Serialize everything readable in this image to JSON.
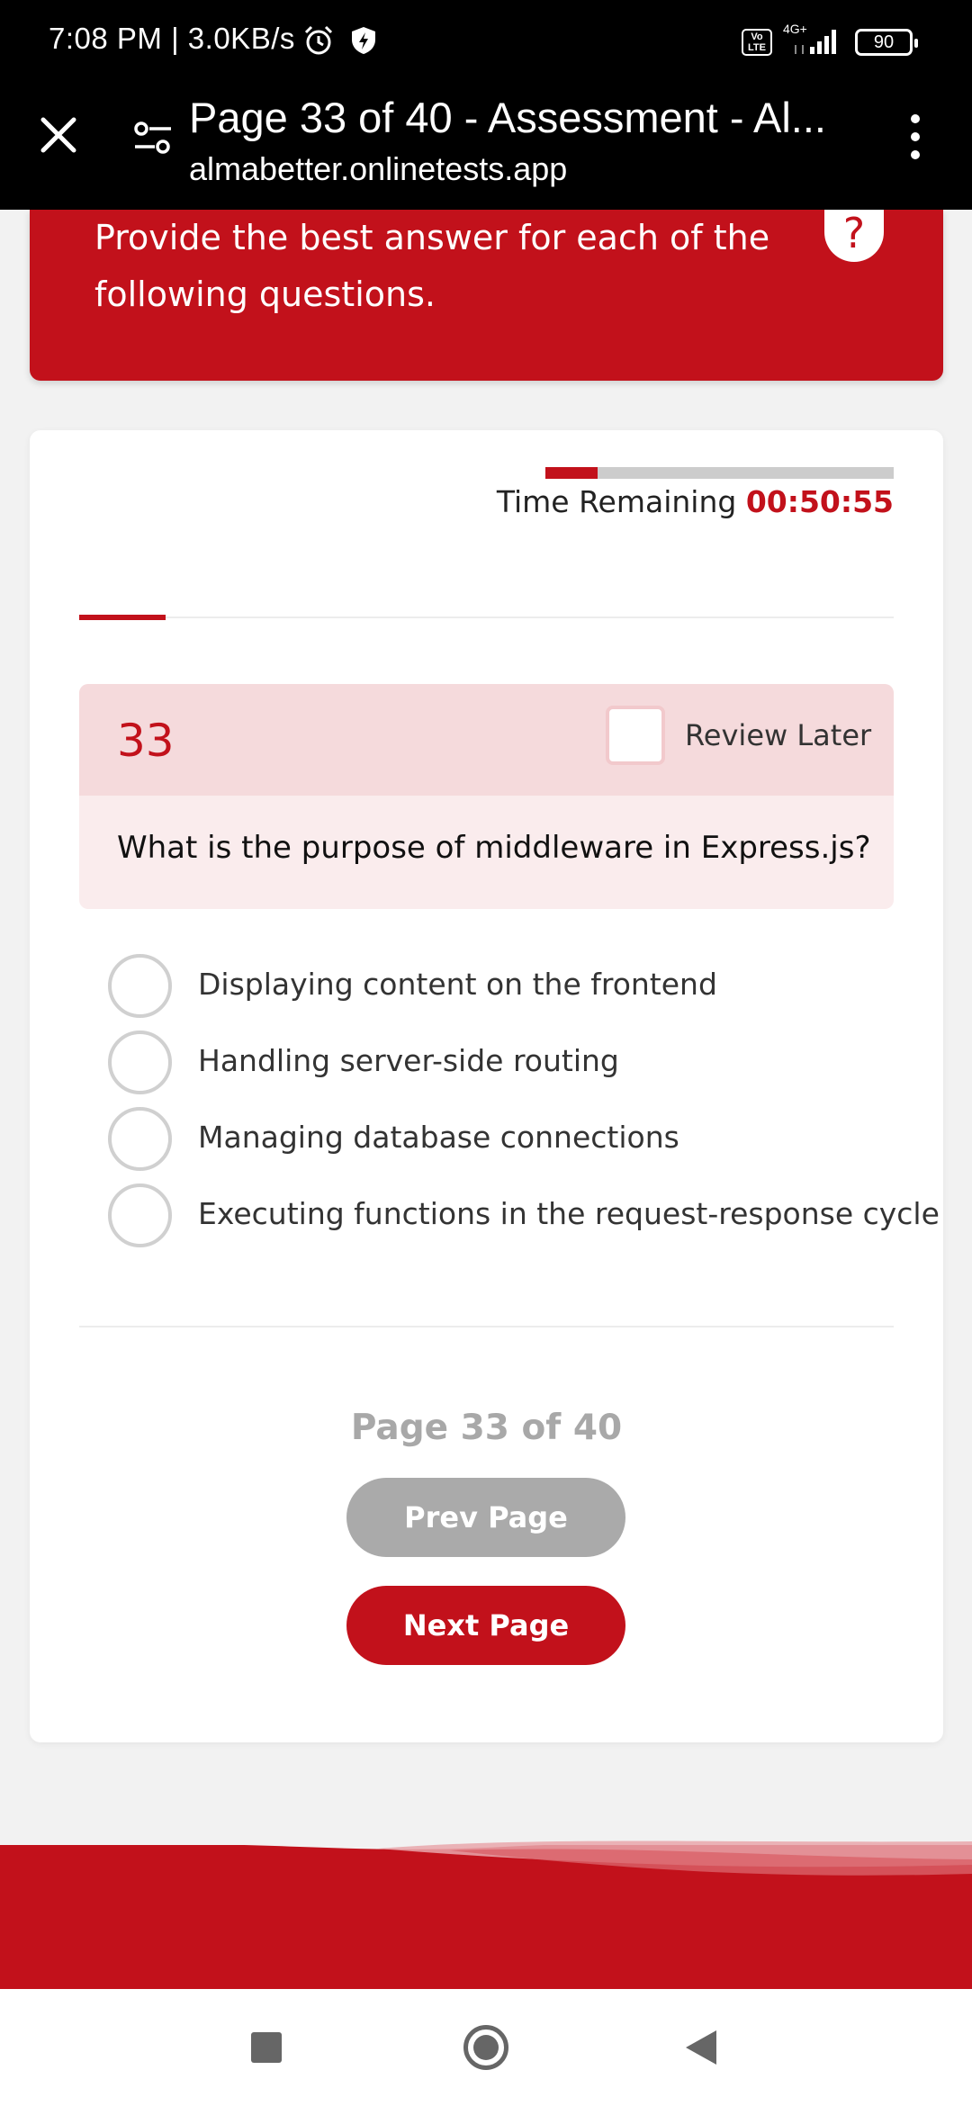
{
  "status_bar": {
    "time_speed": "7:08 PM | 3.0KB/s",
    "volte": "Vo\nLTE",
    "network": "4G+",
    "battery": "90"
  },
  "browser": {
    "title": "Page 33 of 40 - Assessment - Al...",
    "url": "almabetter.onlinetests.app"
  },
  "banner": {
    "instruction": "Provide the best answer for each of the following questions.",
    "help": "?"
  },
  "timer": {
    "label": "Time Remaining",
    "value": "00:50:55",
    "progress_fraction": 0.15
  },
  "question": {
    "number": "33",
    "review_label": "Review Later",
    "text": "What is the purpose of middleware in Express.js?",
    "options": [
      "Displaying content on the frontend",
      "Handling server-side routing",
      "Managing database connections",
      "Executing functions in the request-response cycle"
    ]
  },
  "pagination": {
    "indicator": "Page 33 of 40",
    "prev_label": "Prev Page",
    "next_label": "Next Page"
  },
  "colors": {
    "brand_red": "#c2111b"
  }
}
